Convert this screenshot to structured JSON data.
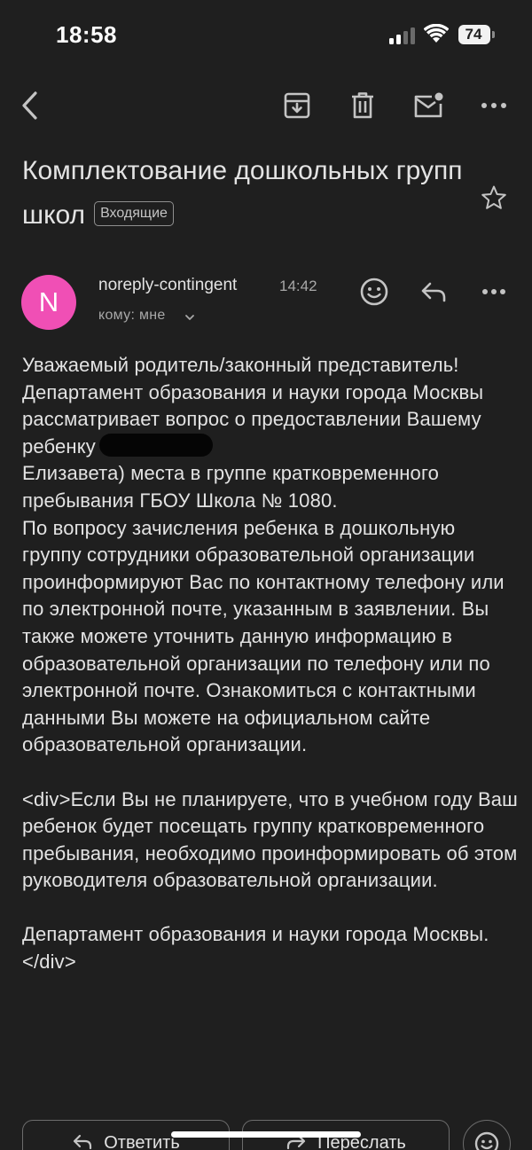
{
  "status_bar": {
    "time": "18:58",
    "battery": "74"
  },
  "toolbar": {
    "icons": [
      "back-arrow-icon",
      "archive-icon",
      "trash-icon",
      "mark-unread-icon",
      "more-icon"
    ]
  },
  "email": {
    "subject": "Комплектование дошкольных групп школ",
    "label": "Входящие",
    "sender": {
      "avatar_letter": "N",
      "avatar_color": "#f04fb5",
      "name": "noreply-contingent",
      "time": "14:42",
      "recipient": "кому: мне"
    },
    "body": {
      "p1_part1": "Уважаемый родитель/законный представитель! Департамент образования и науки города Москвы рассматривает вопрос о предоставлении Вашему ребенку",
      "p1_part2": "Елизавета) места в группе кратковременного пребывания ГБОУ Школа № 1080.",
      "p2": "По вопросу зачисления ребенка в дошкольную группу сотрудники образовательной организации проинформируют Вас по контактному телефону или по электронной почте, указанным в заявлении. Вы также можете уточнить данную информацию в образовательной организации по телефону или по электронной почте. Ознакомиться с контактными данными Вы можете на официальном сайте образовательной организации.",
      "p3": "<div>Если Вы не планируете, что в учебном году Ваш ребенок будет посещать группу кратковременного пребывания, необходимо проинформировать об этом руководителя образовательной организации.",
      "p4": "Департамент образования и науки города Москвы.</div>"
    }
  },
  "bottom_bar": {
    "reply_label": "Ответить",
    "forward_label": "Переслать"
  }
}
